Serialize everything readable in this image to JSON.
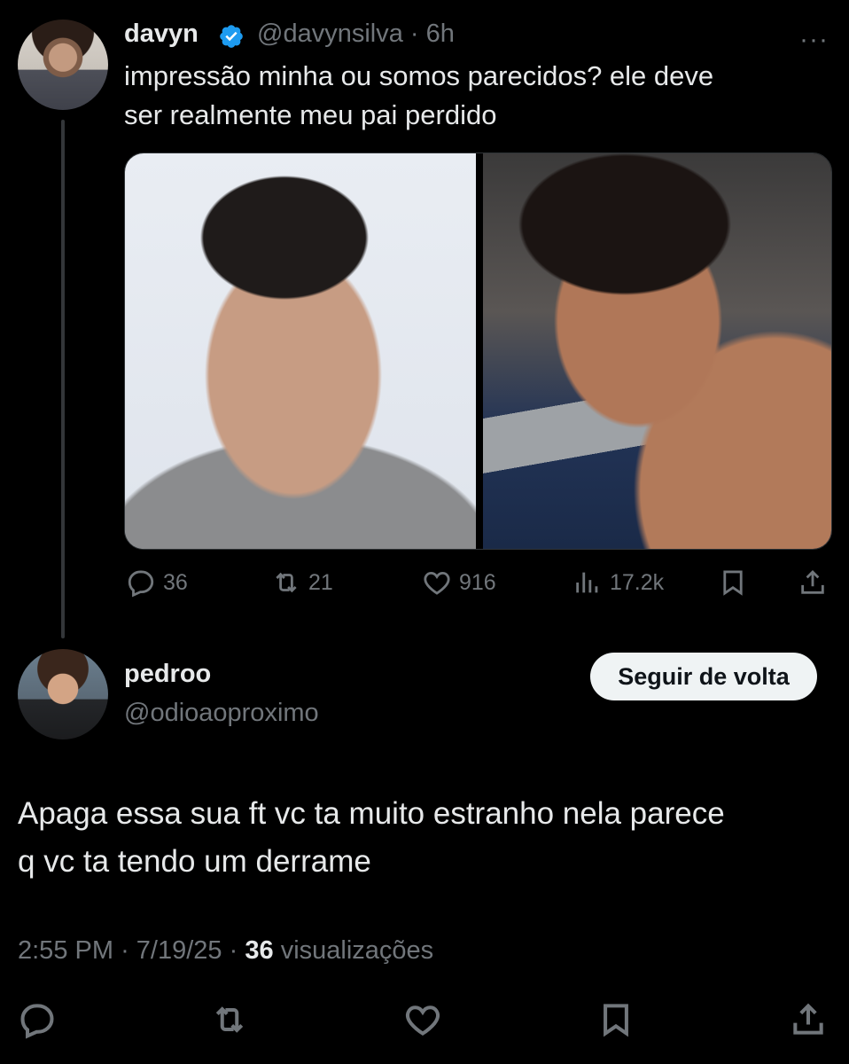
{
  "parent_tweet": {
    "display_name": "davyn",
    "handle": "@davynsilva",
    "time_separator": "·",
    "time": "6h",
    "more_label": "···",
    "text_line1": "impressão minha ou somos parecidos? ele deve",
    "text_line2": "ser realmente meu pai perdido",
    "stats": {
      "replies": "36",
      "reposts": "21",
      "likes": "916",
      "views": "17.2k"
    }
  },
  "reply_tweet": {
    "display_name": "pedroo",
    "handle": "@odioaoproximo",
    "follow_button": "Seguir de volta",
    "text_line1": "Apaga essa sua ft vc ta muito estranho nela parece",
    "text_line2": "q vc ta tendo um derrame",
    "time": "2:55 PM",
    "sep1": "·",
    "date": "7/19/25",
    "sep2": "·",
    "view_count": "36",
    "view_label": "visualizações"
  },
  "colors": {
    "background": "#000000",
    "text_primary": "#e7e9ea",
    "text_secondary": "#71767b",
    "verified": "#1d9bf0",
    "button_bg": "#eff3f4"
  },
  "icons": [
    "verified-badge-icon",
    "reply-icon",
    "repost-icon",
    "like-icon",
    "views-icon",
    "bookmark-icon",
    "share-icon"
  ]
}
